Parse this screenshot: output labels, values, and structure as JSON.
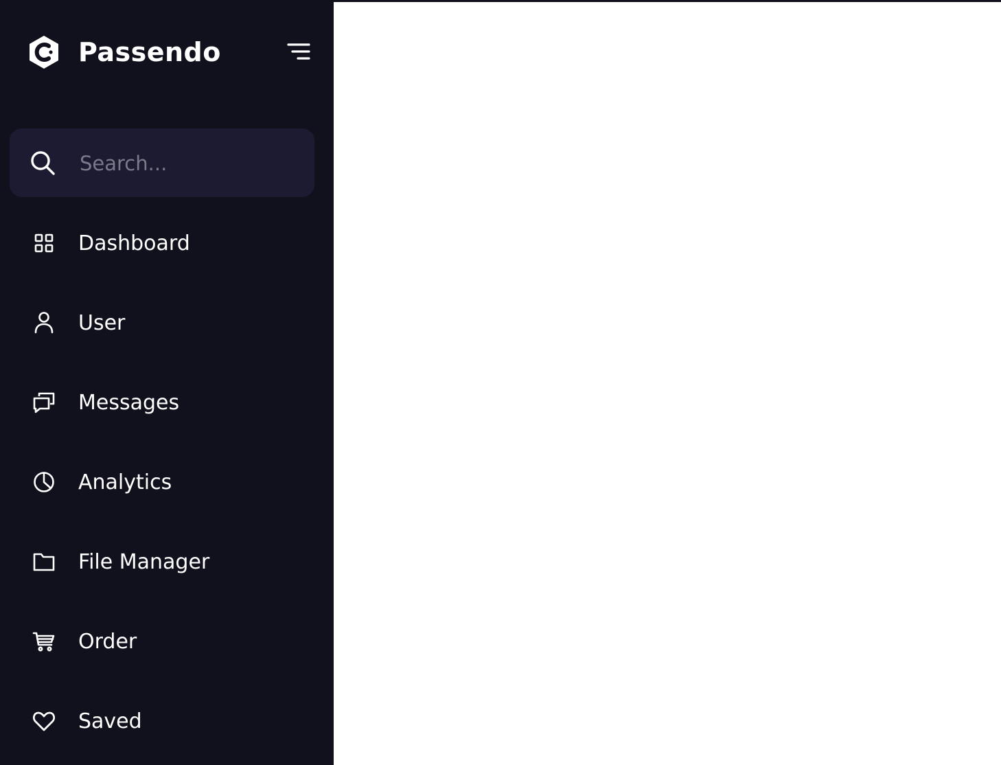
{
  "brand": {
    "name": "Passendo",
    "logo_icon": "brand-logo-c-icon"
  },
  "header": {
    "menu_toggle_icon": "menu-lines-icon"
  },
  "search": {
    "placeholder": "Search...",
    "value": "",
    "icon": "search-icon"
  },
  "sidebar": {
    "items": [
      {
        "label": "Dashboard",
        "icon": "grid-icon"
      },
      {
        "label": "User",
        "icon": "user-icon"
      },
      {
        "label": "Messages",
        "icon": "chat-icon"
      },
      {
        "label": "Analytics",
        "icon": "pie-chart-icon"
      },
      {
        "label": "File Manager",
        "icon": "folder-icon"
      },
      {
        "label": "Order",
        "icon": "cart-icon"
      },
      {
        "label": "Saved",
        "icon": "heart-icon"
      }
    ]
  },
  "colors": {
    "sidebar_bg": "#11101d",
    "search_bg": "#1d1b31",
    "text": "#ffffff",
    "placeholder": "#7a7a8a",
    "main_bg": "#ffffff"
  }
}
